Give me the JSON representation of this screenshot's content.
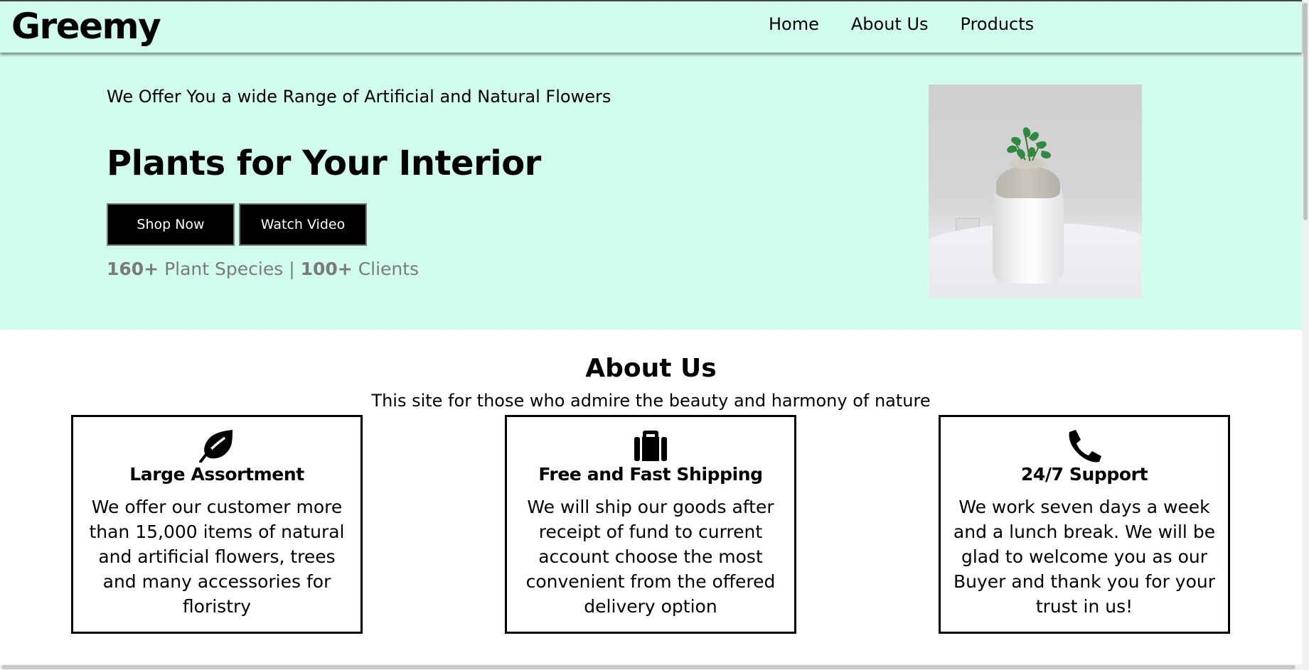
{
  "nav": {
    "brand": "Greemy",
    "links": [
      "Home",
      "About Us",
      "Products"
    ]
  },
  "hero": {
    "tagline": "We Offer You a wide Range of Artificial and Natural Flowers",
    "title": "Plants for Your Interior",
    "shop_button": "Shop Now",
    "video_button": "Watch Video",
    "stats": {
      "species_count": "160+",
      "species_label": "Plant Species",
      "separator": "|",
      "clients_count": "100+",
      "clients_label": "Clients"
    },
    "image_alt": "white vase with green eucalyptus sprig on a table"
  },
  "about": {
    "title": "About Us",
    "subtitle": "This site for those who admire the beauty and harmony of nature",
    "cards": [
      {
        "icon": "leaf-icon",
        "title": "Large Assortment",
        "text": "We offer our customer more than 15,000 items of natural and artificial flowers, trees and many accessories for floristry"
      },
      {
        "icon": "suitcase-icon",
        "title": "Free and Fast Shipping",
        "text": "We will ship our goods after receipt of fund to current account choose the most convenient from the offered delivery option"
      },
      {
        "icon": "phone-icon",
        "title": "24/7 Support",
        "text": "We work seven days a week and a lunch break. We will be glad to welcome you as our Buyer and thank you for your trust in us!"
      }
    ]
  },
  "colors": {
    "mint_background": "#d1fdee",
    "button_background": "#000000",
    "stats_text": "#7a7a7a"
  }
}
